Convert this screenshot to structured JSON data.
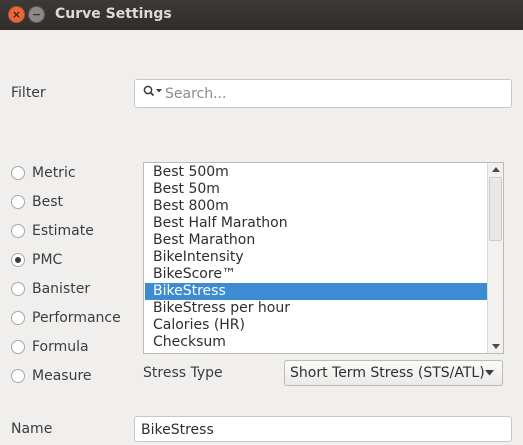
{
  "window": {
    "title": "Curve Settings",
    "close_glyph": "×",
    "minimize_glyph": "−"
  },
  "filter": {
    "label": "Filter",
    "placeholder": "Search..."
  },
  "curve_types": [
    {
      "label": "Metric",
      "selected": false
    },
    {
      "label": "Best",
      "selected": false
    },
    {
      "label": "Estimate",
      "selected": false
    },
    {
      "label": "PMC",
      "selected": true
    },
    {
      "label": "Banister",
      "selected": false
    },
    {
      "label": "Performance",
      "selected": false
    },
    {
      "label": "Formula",
      "selected": false
    },
    {
      "label": "Measure",
      "selected": false
    }
  ],
  "metric_list": {
    "items": [
      "Best 500m",
      "Best 50m",
      "Best 800m",
      "Best Half Marathon",
      "Best Marathon",
      "BikeIntensity",
      "BikeScore™",
      "BikeStress",
      "BikeStress per hour",
      "Calories (HR)",
      "Checksum"
    ],
    "selected_index": 7
  },
  "stress_type": {
    "label": "Stress Type",
    "value": "Short Term Stress (STS/ATL)"
  },
  "name": {
    "label": "Name",
    "value": "BikeStress"
  },
  "colors": {
    "selection": "#3d8cd3",
    "titlebar": "#3b3a37",
    "close_button": "#e9683a"
  }
}
